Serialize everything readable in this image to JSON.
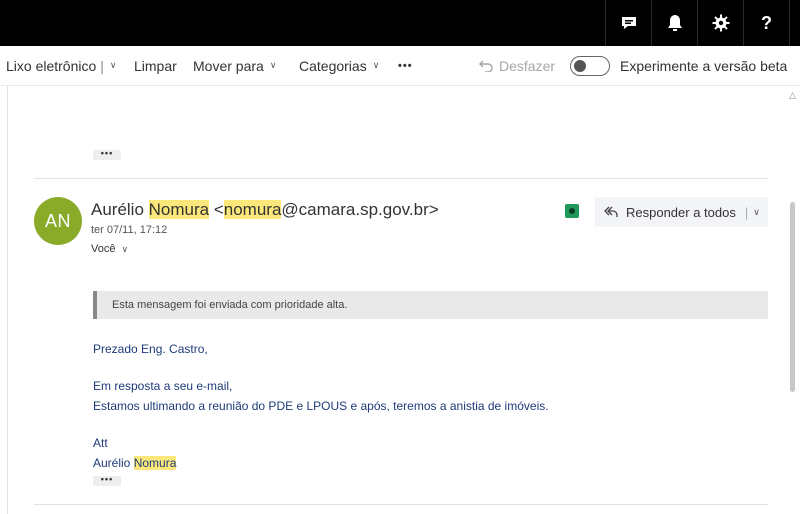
{
  "topbar": {
    "icons": [
      "chat-icon",
      "bell-icon",
      "gear-icon",
      "help-icon"
    ]
  },
  "toolbar": {
    "junk_label": "Lixo eletrônico",
    "junk_separator": "|",
    "clear_label": "Limpar",
    "move_label": "Mover para",
    "categories_label": "Categorias",
    "more_label": "•••",
    "undo_label": "Desfazer",
    "beta_label": "Experimente a versão beta"
  },
  "message": {
    "more_dots": "•••",
    "sender_first": "Aurélio ",
    "sender_highlight": "Nomura",
    "email_open": " <",
    "email_highlight": "nomura",
    "email_rest": "@camara.sp.gov.br>",
    "avatar_initials": "AN",
    "avatar_color": "#8aab2a",
    "date": "ter 07/11, 17:12",
    "recipient": "Você",
    "reply_all_label": "Responder a todos",
    "priority_notice": "Esta mensagem foi enviada com prioridade alta.",
    "body": {
      "greeting": "Prezado Eng. Castro,",
      "line1": "Em resposta a seu e-mail,",
      "line2": "Estamos ultimando a reunião do PDE e LPOUS e após, teremos a anistia de imóveis.",
      "closing": "Att",
      "signature_first": "Aurélio ",
      "signature_highlight": "Nomura"
    }
  }
}
